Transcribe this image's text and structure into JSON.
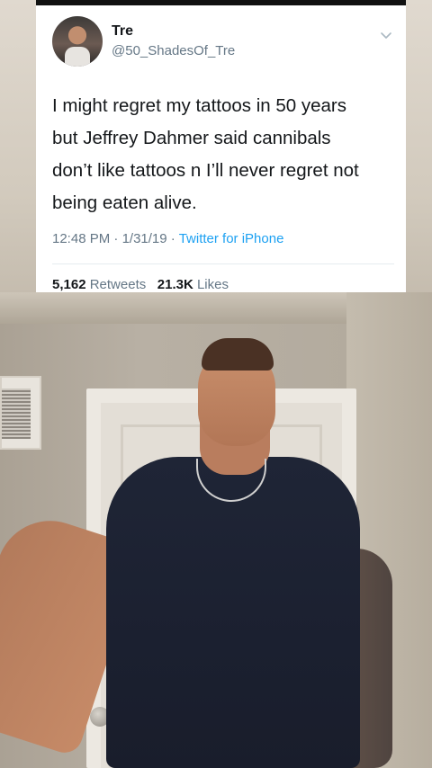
{
  "tweet": {
    "display_name": "Tre",
    "handle": "@50_ShadesOf_Tre",
    "lines": [
      "I might regret my tattoos in 50 years",
      "but Jeffrey Dahmer said cannibals",
      "don’t like tattoos n I’ll never regret not",
      "being eaten alive."
    ],
    "time": "12:48 PM",
    "date": "1/31/19",
    "separator": "·",
    "source": "Twitter for iPhone",
    "retweets_count": "5,162",
    "retweets_label": "Retweets",
    "likes_count": "21.3K",
    "likes_label": "Likes",
    "caret_icon": "chevron-down-icon",
    "avatar_icon": "profile-avatar"
  },
  "colors": {
    "text": "#14171a",
    "secondary": "#657786",
    "link": "#1da1f2",
    "card": "#ffffff"
  }
}
